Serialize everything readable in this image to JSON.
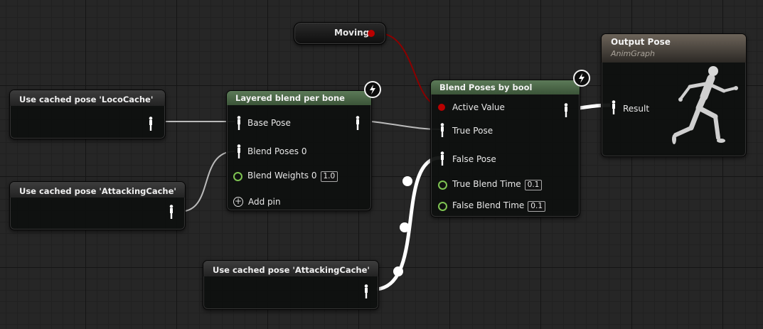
{
  "graph": {
    "moving_node": {
      "label": "Moving"
    },
    "cache_loco": {
      "title": "Use cached pose 'LocoCache'"
    },
    "cache_attack_1": {
      "title": "Use cached pose 'AttackingCache'"
    },
    "cache_attack_2": {
      "title": "Use cached pose 'AttackingCache'"
    },
    "layered_blend": {
      "title": "Layered blend per bone",
      "base_pose": "Base Pose",
      "blend_poses": "Blend Poses 0",
      "blend_weights": "Blend Weights 0",
      "blend_weights_value": "1.0",
      "add_pin": "Add pin"
    },
    "blend_bool": {
      "title": "Blend Poses by bool",
      "active_value": "Active Value",
      "true_pose": "True Pose",
      "false_pose": "False Pose",
      "true_blend_time": "True Blend Time",
      "true_blend_time_value": "0.1",
      "false_blend_time": "False Blend Time",
      "false_blend_time_value": "0.1"
    },
    "output_pose": {
      "title": "Output Pose",
      "subtitle": "AnimGraph",
      "result": "Result"
    }
  },
  "colors": {
    "node_header_green": "#4c6a48",
    "bool_pin": "#b90000",
    "float_pin": "#7ec352",
    "exec_wire": "#ffffff"
  },
  "icons": [
    "pose-pin-icon",
    "lightning-icon",
    "add-pin-icon",
    "mannequin-preview-icon"
  ]
}
